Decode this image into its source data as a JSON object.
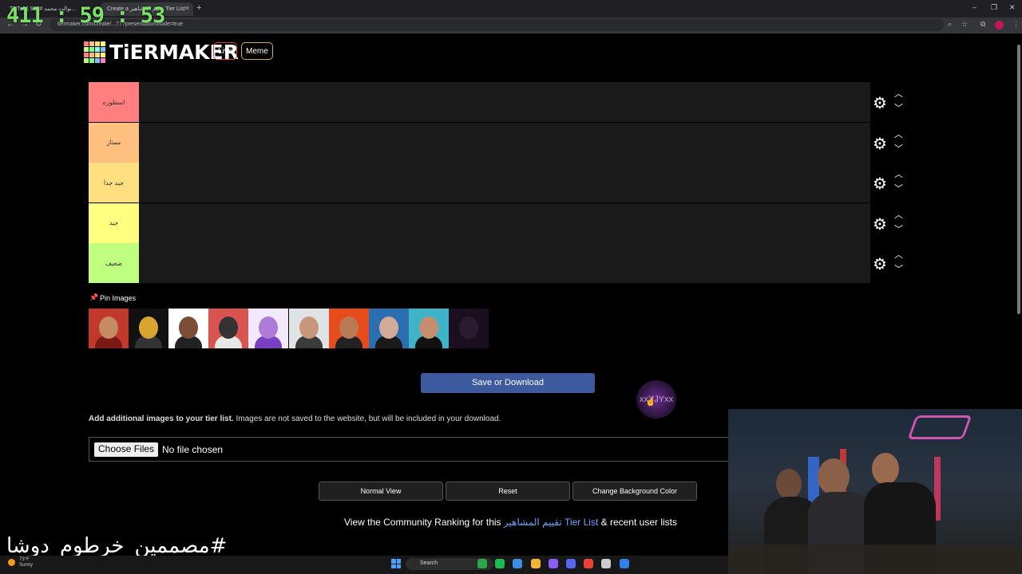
{
  "browser": {
    "tabs": [
      {
        "title": "TikTok | نوالت محمد #999..."
      },
      {
        "title": "Create a تقييم المشاهير Tier List"
      }
    ],
    "url": "tiermaker.com/create/...77?presentationMode=true"
  },
  "overlay": {
    "timer": "411 : 59 : 53",
    "hashtag": "#مصممين_خرطوم_دوشا"
  },
  "header": {
    "logo_text": "TiERMAKER",
    "live_label": "Live",
    "meme_label": "Meme",
    "logo_colors": [
      "#ff7f7f",
      "#ffbf7f",
      "#ffdf7f",
      "#ffff7f",
      "#bfff7f",
      "#7fff7f",
      "#7fffff",
      "#7fbfff",
      "#ff7f7f",
      "#ffbf7f",
      "#ffdf7f",
      "#ffff7f",
      "#bfff7f",
      "#7fff7f",
      "#7fbfff",
      "#ff7fbf"
    ]
  },
  "tiers": [
    {
      "label": "اسطوره",
      "color": "#ff7f7f"
    },
    {
      "label": "ممتاز",
      "color": "#ffbf7f"
    },
    {
      "label": "جيد جدا",
      "color": "#ffdf7f"
    },
    {
      "label": "جيد",
      "color": "#ffff7f"
    },
    {
      "label": "ضعيف",
      "color": "#bfff7f"
    }
  ],
  "pin_images": {
    "label": "Pin Images",
    "thumbs": [
      {
        "bg": "#c0392b",
        "face": "#c58b63",
        "body": "#7a1a12"
      },
      {
        "bg": "#111111",
        "face": "#d9a531",
        "body": "#333333"
      },
      {
        "bg": "#ffffff",
        "face": "#7a4f35",
        "body": "#222222"
      },
      {
        "bg": "#d9534f",
        "face": "#333333",
        "body": "#e8e8e8"
      },
      {
        "bg": "#f2e9ff",
        "face": "#b07ad9",
        "body": "#7b3fc4"
      },
      {
        "bg": "#dfe3e6",
        "face": "#c8967a",
        "body": "#3b3b3b"
      },
      {
        "bg": "#e74c1c",
        "face": "#b97a58",
        "body": "#222222"
      },
      {
        "bg": "#2b6fb0",
        "face": "#d4aa9a",
        "body": "#1a1a1a"
      },
      {
        "bg": "#3fb4c9",
        "face": "#c68e6d",
        "body": "#111111"
      },
      {
        "bg": "#1a0f1e",
        "face": "#2a1b30",
        "body": "#1a0f1e"
      }
    ]
  },
  "save_button": "Save or Download",
  "dragging_thumb_text": "xxYJYxx",
  "add_images": {
    "bold": "Add additional images to your tier list.",
    "rest": " Images are not saved to the website, but will be included in your download."
  },
  "file_input": {
    "button": "Choose Files",
    "status": "No file chosen"
  },
  "bottom_buttons": {
    "normal_view": "Normal View",
    "reset": "Reset",
    "change_bg": "Change Background Color"
  },
  "community": {
    "prefix": "View the Community Ranking for this ",
    "link": "تقييم المشاهير Tier List",
    "suffix": " & recent user lists"
  },
  "taskbar": {
    "weather_temp": "73°F",
    "weather_desc": "Sunny",
    "search_label": "Search",
    "app_colors": [
      "#2aa748",
      "#1db954",
      "#3a8ee6",
      "#f2b632",
      "#8a5cf5",
      "#5865f2",
      "#ea4335",
      "#cccccc",
      "#2f80ed"
    ]
  }
}
